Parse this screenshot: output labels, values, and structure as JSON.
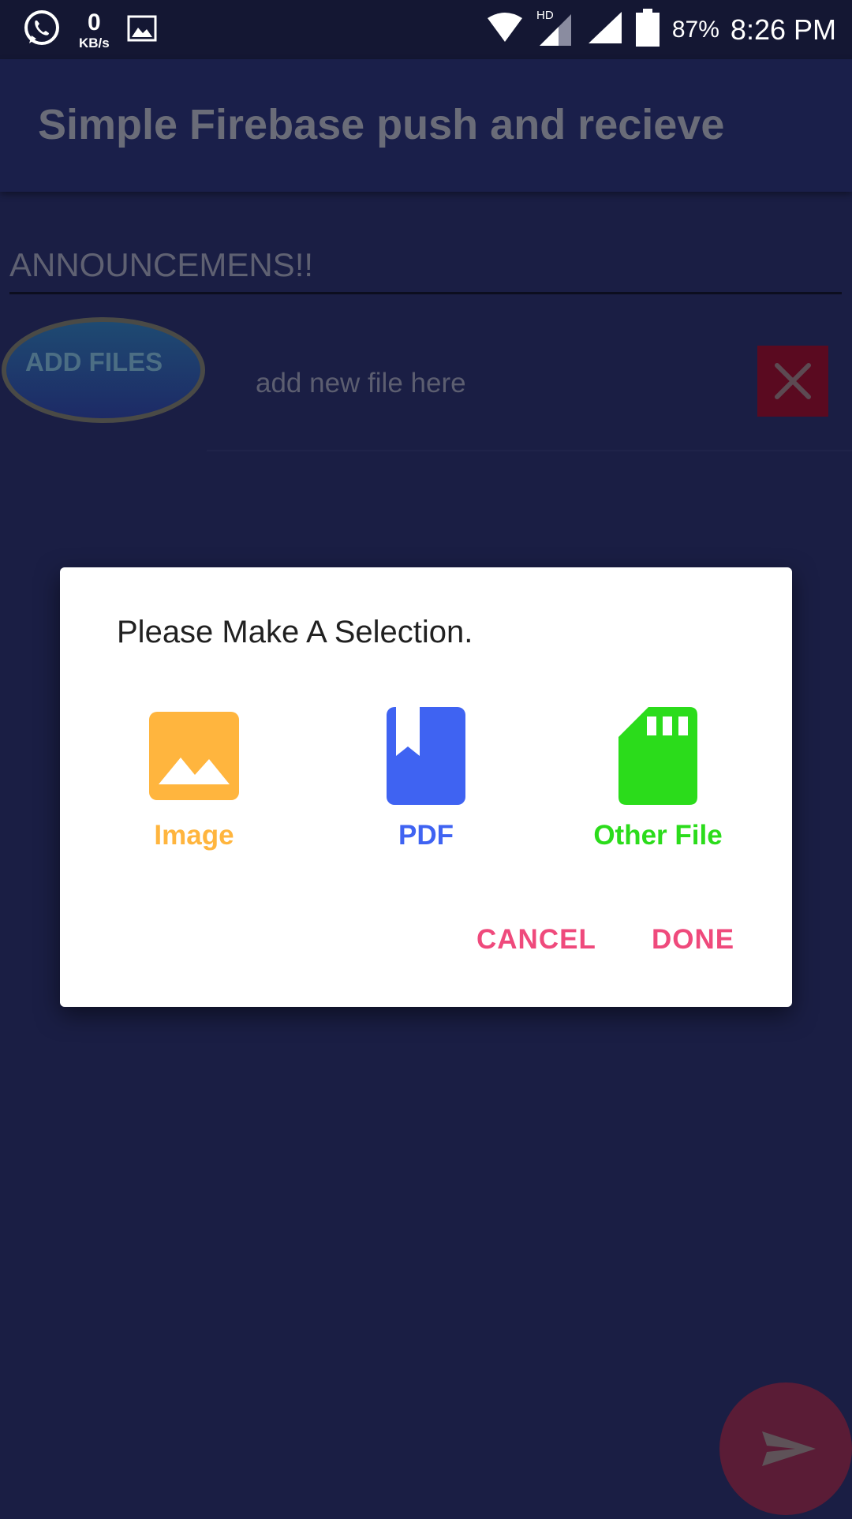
{
  "status_bar": {
    "net_speed_value": "0",
    "net_speed_unit": "KB/s",
    "battery_percent": "87%",
    "time": "8:26 PM",
    "icons": [
      "whatsapp-icon",
      "gallery-icon",
      "wifi-icon",
      "hd-signal-icon",
      "signal-icon",
      "battery-icon"
    ]
  },
  "app_bar": {
    "title": "Simple Firebase push and recieve"
  },
  "form": {
    "headline": "ANNOUNCEMENS!!",
    "add_files_label": "ADD FILES",
    "file_placeholder": "add new file here"
  },
  "dialog": {
    "title": "Please Make A Selection.",
    "options": [
      {
        "label": "Image",
        "icon": "image-icon",
        "color": "#ffb53e"
      },
      {
        "label": "PDF",
        "icon": "pdf-book-icon",
        "color": "#3f63f2"
      },
      {
        "label": "Other File",
        "icon": "sd-card-icon",
        "color": "#2bdc1b"
      }
    ],
    "cancel_label": "CANCEL",
    "done_label": "DONE"
  },
  "colors": {
    "background": "#1a1e44",
    "accent": "#ef4a7c",
    "status_bar": "#141733"
  }
}
